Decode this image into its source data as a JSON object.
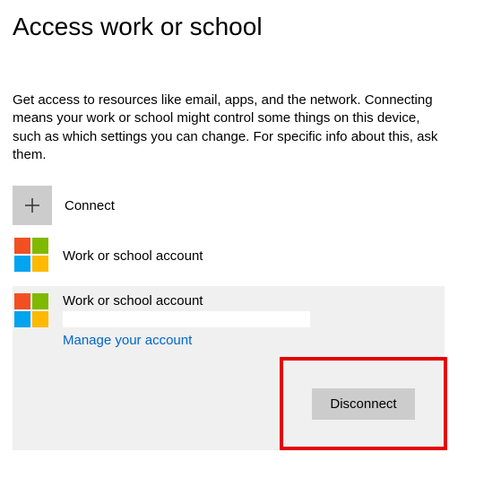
{
  "title": "Access work or school",
  "description": "Get access to resources like email, apps, and the network. Connecting means your work or school might control some things on this device, such as which settings you can change. For specific info about this, ask them.",
  "connect": {
    "label": "Connect"
  },
  "accounts": [
    {
      "label": "Work or school account"
    }
  ],
  "expanded": {
    "title": "Work or school account",
    "manage_link": "Manage your account",
    "disconnect": "Disconnect"
  }
}
